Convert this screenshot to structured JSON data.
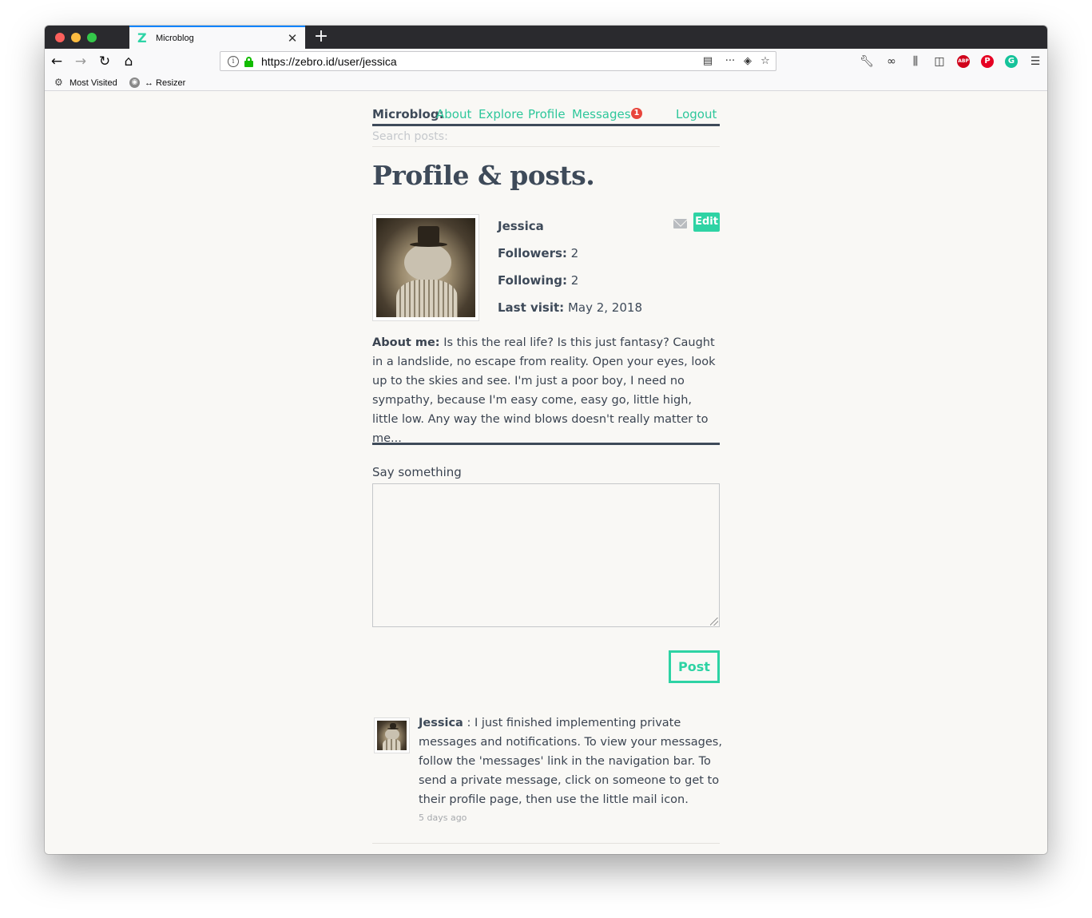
{
  "browser": {
    "tab_title": "Microblog",
    "tab_favicon": "Z",
    "url": "https://zebro.id/user/jessica",
    "bookmarks": [
      "Most Visited",
      "↔ Resizer"
    ]
  },
  "nav": {
    "brand": "Microblog:",
    "links": [
      "About",
      "Explore",
      "Profile",
      "Messages",
      "Logout"
    ],
    "messages_badge": "1"
  },
  "search": {
    "placeholder": "Search posts:"
  },
  "page": {
    "title": "Profile & posts."
  },
  "profile": {
    "name": "Jessica",
    "followers_label": "Followers:",
    "followers": "2",
    "following_label": "Following:",
    "following": "2",
    "last_visit_label": "Last visit:",
    "last_visit": "May 2, 2018",
    "edit_label": "Edit",
    "about_label": "About me:",
    "about_text": "Is this the real life? Is this just fantasy? Caught in a landslide, no escape from reality. Open your eyes, look up to the skies and see. I'm just a poor boy, I need no sympathy, because I'm easy come, easy go, little high, little low. Any way the wind blows doesn't really matter to me..."
  },
  "composer": {
    "label": "Say something",
    "value": "",
    "submit_label": "Post"
  },
  "posts": [
    {
      "author": "Jessica",
      "separator": " : ",
      "body": "I just finished implementing private messages and notifications. To view your messages, follow the 'messages' link in the navigation bar. To send a private message, click on someone to get to their profile page, then use the little mail icon.",
      "time": "5 days ago"
    }
  ],
  "colors": {
    "accent": "#2ed3a4",
    "text": "#3e4a59",
    "badge": "#e8453c"
  }
}
